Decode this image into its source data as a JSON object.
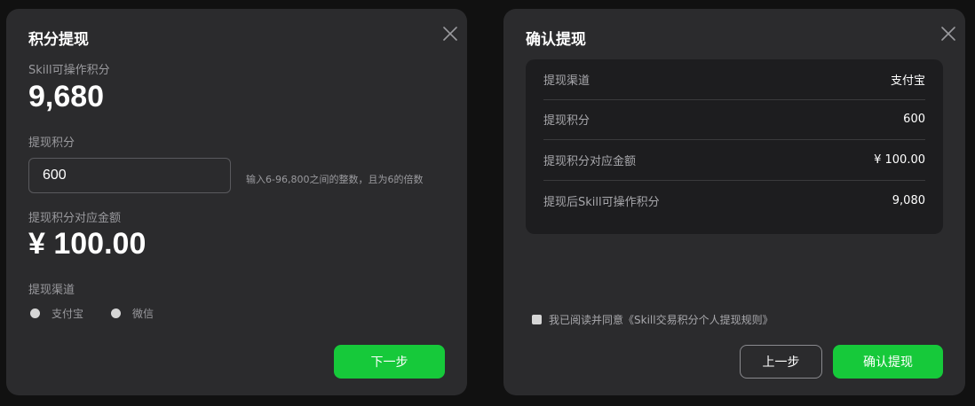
{
  "withdraw": {
    "title": "积分提现",
    "operable_label": "Skill可操作积分",
    "operable_points": "9,680",
    "amount_label": "提现积分",
    "amount_value": "600",
    "amount_hint": "输入6-96,800之间的整数，且为6的倍数",
    "money_label": "提现积分对应金额",
    "money_value": "¥ 100.00",
    "channel_label": "提现渠道",
    "channels": [
      "支付宝",
      "微信"
    ],
    "next_label": "下一步"
  },
  "confirm": {
    "title": "确认提现",
    "rows": [
      {
        "key": "提现渠道",
        "value": "支付宝"
      },
      {
        "key": "提现积分",
        "value": "600"
      },
      {
        "key": "提现积分对应金额",
        "value": "¥ 100.00"
      },
      {
        "key": "提现后Skill可操作积分",
        "value": "9,080"
      }
    ],
    "agree_text": "我已阅读并同意《Skill交易积分个人提现规则》",
    "prev_label": "上一步",
    "confirm_label": "确认提现"
  },
  "colors": {
    "background": "#111111",
    "panel": "#2b2b2d",
    "card": "#1d1d1f",
    "accent": "#16c93a"
  },
  "icons": {
    "close": "close-icon"
  }
}
